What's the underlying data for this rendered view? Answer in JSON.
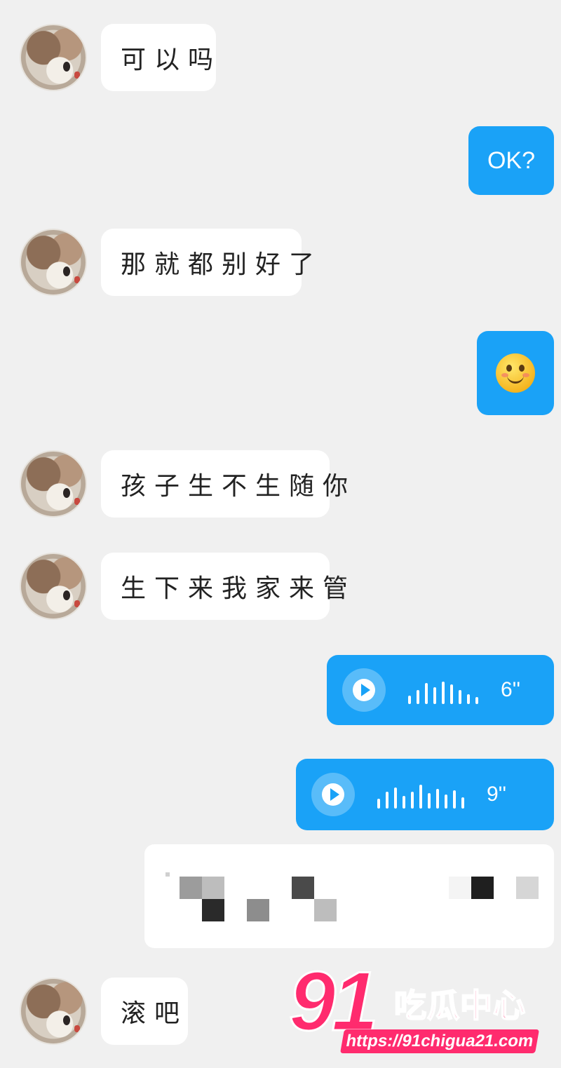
{
  "messages": [
    {
      "side": "left",
      "text": "可以吗"
    },
    {
      "side": "right",
      "text": "OK?"
    },
    {
      "side": "left",
      "text": "那就都别好了"
    },
    {
      "side": "right",
      "icon": "smiley-emoji-icon"
    },
    {
      "side": "left",
      "text": "孩子生不生随你"
    },
    {
      "side": "left",
      "text": "生下来我家来管"
    },
    {
      "side": "right",
      "voice_duration": "6''"
    },
    {
      "side": "right",
      "voice_duration": "9''"
    },
    {
      "side": "right",
      "redacted": true
    },
    {
      "side": "left",
      "text": "滚吧"
    }
  ],
  "colors": {
    "background": "#f0f0f0",
    "outgoing_bubble": "#1aa2f7",
    "incoming_bubble": "#ffffff",
    "watermark": "#ff2b6e"
  },
  "watermark": {
    "number": "91",
    "name": "吃瓜中心",
    "url": "https://91chigua21.com"
  }
}
